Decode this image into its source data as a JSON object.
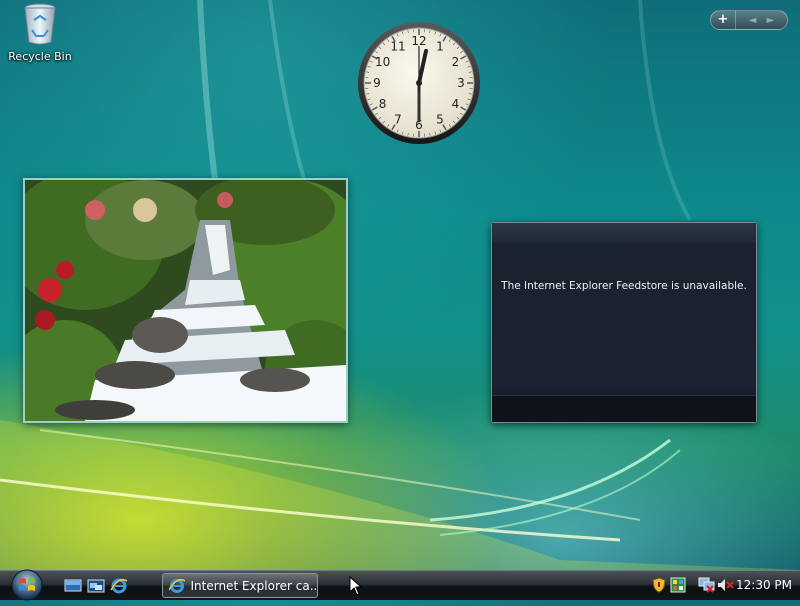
{
  "desktop": {
    "icons": [
      {
        "label": "Recycle Bin",
        "icon": "recycle-bin-icon"
      }
    ]
  },
  "sidebar": {
    "add_label": "+",
    "prev_label": "◄",
    "next_label": "►"
  },
  "clock": {
    "numerals": [
      "12",
      "1",
      "2",
      "3",
      "4",
      "5",
      "6",
      "7",
      "8",
      "9",
      "10",
      "11"
    ],
    "time_shown": "12:30"
  },
  "slideshow": {
    "subject": "waterfall-photo"
  },
  "feed_headlines": {
    "message": "The Internet Explorer Feedstore is unavailable."
  },
  "taskbar": {
    "start_icon": "windows-orb-icon",
    "quick_launch": [
      {
        "icon": "show-desktop-icon"
      },
      {
        "icon": "switch-windows-icon"
      },
      {
        "icon": "internet-explorer-icon"
      }
    ],
    "tasks": [
      {
        "label": "Internet Explorer ca...",
        "icon": "internet-explorer-icon"
      }
    ],
    "tray": {
      "icons": [
        "security-shield-icon",
        "sidebar-icon",
        "network-icon",
        "volume-muted-icon"
      ],
      "time": "12:30 PM"
    }
  },
  "colors": {
    "taskbar": "#1b2025",
    "desktop_teal": "#0d8a8c",
    "accent_yellow": "#d6e628"
  }
}
